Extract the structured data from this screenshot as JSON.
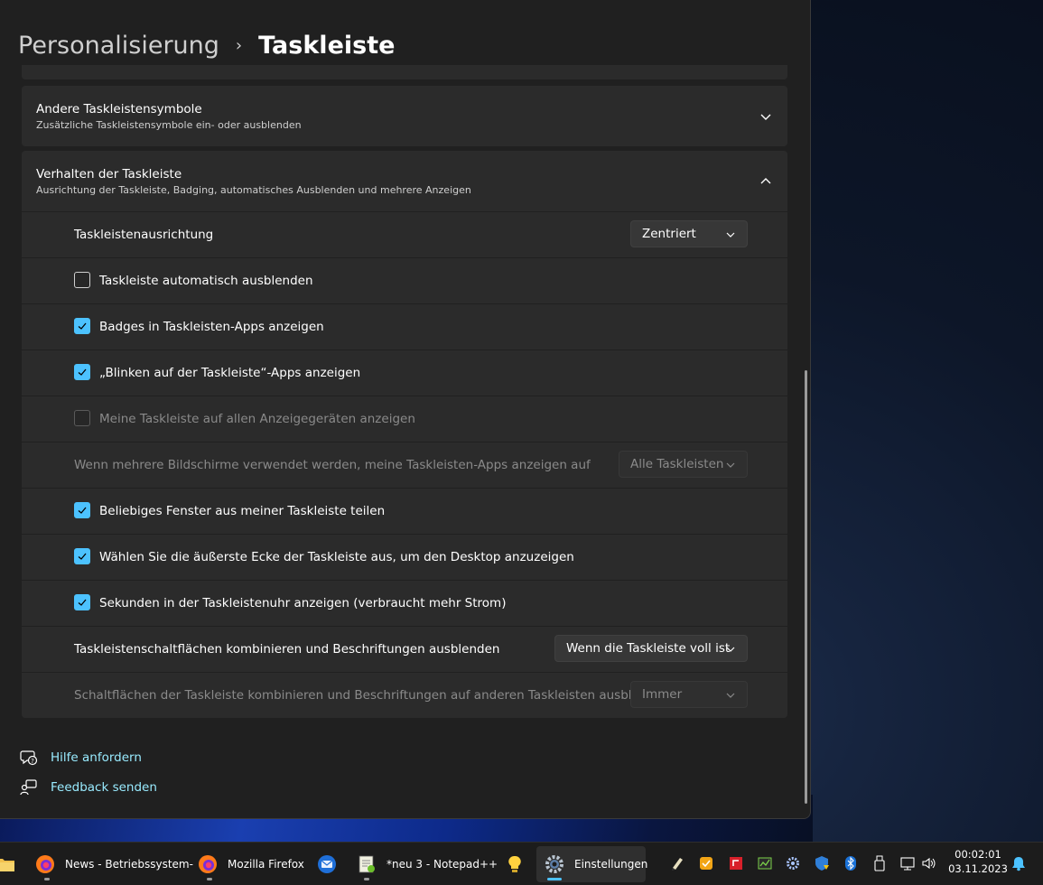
{
  "breadcrumb": {
    "parent": "Personalisierung",
    "separator": "›",
    "current": "Taskleiste"
  },
  "sections": {
    "other_icons": {
      "title": "Andere Taskleistensymbole",
      "subtitle": "Zusätzliche Taskleistensymbole ein- oder ausblenden"
    },
    "behavior": {
      "title": "Verhalten der Taskleiste",
      "subtitle": "Ausrichtung der Taskleiste, Badging, automatisches Ausblenden und mehrere Anzeigen"
    }
  },
  "settings": {
    "alignment": {
      "label": "Taskleistenausrichtung",
      "value": "Zentriert"
    },
    "autohide": {
      "label": "Taskleiste automatisch ausblenden",
      "checked": false
    },
    "badges": {
      "label": "Badges in Taskleisten-Apps anzeigen",
      "checked": true
    },
    "flashing": {
      "label": "„Blinken auf der Taskleiste“-Apps anzeigen",
      "checked": true
    },
    "all_displays": {
      "label": "Meine Taskleiste auf allen Anzeigegeräten anzeigen",
      "checked": false,
      "disabled": true
    },
    "multi_monitor": {
      "label": "Wenn mehrere Bildschirme verwendet werden, meine Taskleisten-Apps anzeigen auf",
      "value": "Alle Taskleisten",
      "disabled": true
    },
    "share_window": {
      "label": "Beliebiges Fenster aus meiner Taskleiste teilen",
      "checked": true
    },
    "corner_desktop": {
      "label": "Wählen Sie die äußerste Ecke der Taskleiste aus, um den Desktop anzuzeigen",
      "checked": true
    },
    "seconds": {
      "label": "Sekunden in der Taskleistenuhr anzeigen (verbraucht mehr Strom)",
      "checked": true
    },
    "combine": {
      "label": "Taskleistenschaltflächen kombinieren und Beschriftungen ausblenden",
      "value": "Wenn die Taskleiste voll ist"
    },
    "combine_other": {
      "label": "Schaltflächen der Taskleiste kombinieren und Beschriftungen auf anderen Taskleisten ausblenden",
      "value": "Immer",
      "disabled": true
    }
  },
  "links": {
    "help": "Hilfe anfordern",
    "feedback": "Feedback senden"
  },
  "taskbar": {
    "apps": [
      {
        "label": "News - Betriebssystem-",
        "icon": "firefox-icon"
      },
      {
        "label": "Mozilla Firefox",
        "icon": "firefox-icon"
      },
      {
        "label": "",
        "icon": "thunderbird-icon"
      },
      {
        "label": "*neu 3 - Notepad++",
        "icon": "notepad-plus-plus-icon"
      },
      {
        "label": "",
        "icon": "lightbulb-icon"
      },
      {
        "label": "Einstellungen",
        "icon": "settings-gear-icon",
        "active": true
      }
    ],
    "clock": {
      "time": "00:02:01",
      "date": "03.11.2023"
    }
  },
  "colors": {
    "accent": "#4cc2ff",
    "link": "#99ebff",
    "card": "#2b2b2b",
    "window": "#202020"
  }
}
